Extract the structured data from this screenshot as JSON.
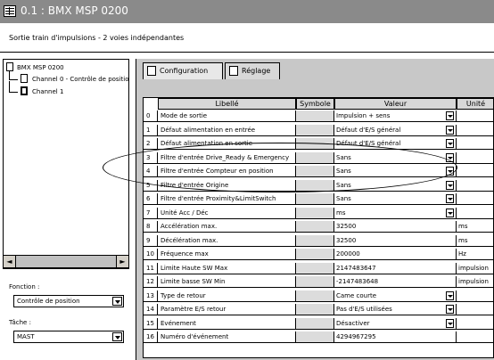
{
  "window": {
    "title": "0.1 : BMX MSP 0200"
  },
  "subtitle": "Sortie train d'impulsions - 2 voies indépendantes",
  "tree": {
    "root": "BMX MSP 0200",
    "channel0": "Channel 0 - Contrôle de position",
    "channel1": "Channel 1"
  },
  "fonction": {
    "label": "Fonction :",
    "value": "Contrôle de position"
  },
  "tache": {
    "label": "Tâche :",
    "value": "MAST"
  },
  "tabs": [
    {
      "label": "Configuration",
      "icon": "config-icon"
    },
    {
      "label": "Réglage",
      "icon": "adjust-icon"
    }
  ],
  "table": {
    "headers": {
      "libelle": "Libellé",
      "symbole": "Symbole",
      "valeur": "Valeur",
      "unite": "Unité"
    },
    "rows": [
      {
        "num": "0",
        "libelle": "Mode de sortie",
        "valeur": "Impulsion + sens",
        "unite": "",
        "dropdown": true
      },
      {
        "num": "1",
        "libelle": "Défaut alimentation en entrée",
        "valeur": "Défaut d'E/S général",
        "unite": "",
        "dropdown": true
      },
      {
        "num": "2",
        "libelle": "Défaut alimentation en sortie",
        "valeur": "Défaut d'E/S général",
        "unite": "",
        "dropdown": true
      },
      {
        "num": "3",
        "libelle": "Filtre d'entrée Drive_Ready & Emergency",
        "valeur": "Sans",
        "unite": "",
        "dropdown": true
      },
      {
        "num": "4",
        "libelle": "Filtre d'entrée Compteur en position",
        "valeur": "Sans",
        "unite": "",
        "dropdown": true
      },
      {
        "num": "5",
        "libelle": "Filtre d'entrée Origine",
        "valeur": "Sans",
        "unite": "",
        "dropdown": true
      },
      {
        "num": "6",
        "libelle": "Filtre d'entrée Proximity&LimitSwitch",
        "valeur": "Sans",
        "unite": "",
        "dropdown": true
      },
      {
        "num": "7",
        "libelle": "Unité Acc / Déc",
        "valeur": "ms",
        "unite": "",
        "dropdown": true
      },
      {
        "num": "8",
        "libelle": "Accélération max.",
        "valeur": "32500",
        "unite": "ms",
        "dropdown": false
      },
      {
        "num": "9",
        "libelle": "Décélération max.",
        "valeur": "32500",
        "unite": "ms",
        "dropdown": false
      },
      {
        "num": "10",
        "libelle": "Fréquence max",
        "valeur": "200000",
        "unite": "Hz",
        "dropdown": false
      },
      {
        "num": "11",
        "libelle": "Limite Haute SW Max",
        "valeur": "2147483647",
        "unite": "impulsion",
        "dropdown": false
      },
      {
        "num": "12",
        "libelle": "Limite basse SW Min",
        "valeur": "-2147483648",
        "unite": "impulsion",
        "dropdown": false
      },
      {
        "num": "13",
        "libelle": "Type de retour",
        "valeur": "Came courte",
        "unite": "",
        "dropdown": true
      },
      {
        "num": "14",
        "libelle": "Paramètre E/S retour",
        "valeur": "Pas d'E/S utilisées",
        "unite": "",
        "dropdown": true
      },
      {
        "num": "15",
        "libelle": "Evénement",
        "valeur": "Désactiver",
        "unite": "",
        "dropdown": true
      },
      {
        "num": "16",
        "libelle": "Numéro d'événement",
        "valeur": "4294967295",
        "unite": "",
        "dropdown": false
      }
    ]
  }
}
